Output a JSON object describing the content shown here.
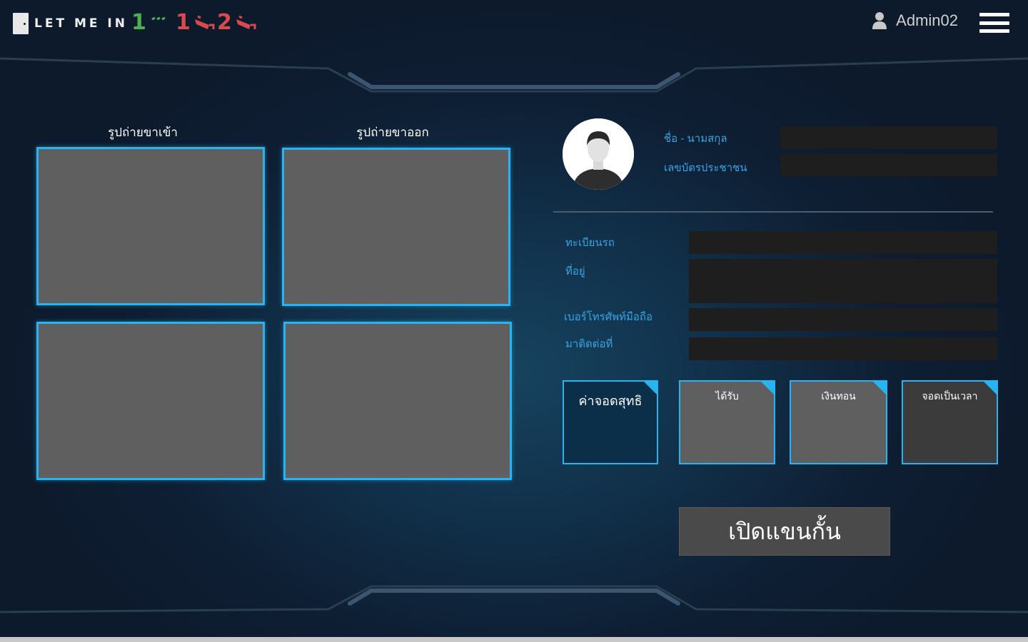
{
  "app": {
    "logo_text": "LET ME IN"
  },
  "status": {
    "gate_count": "1",
    "camera1_count": "1",
    "camera2_count": "2"
  },
  "user": {
    "name": "Admin02"
  },
  "photos": {
    "entry_title": "รูปถ่ายขาเข้า",
    "exit_title": "รูปถ่ายขาออก"
  },
  "profile": {
    "name_label": "ชื่อ - นามสกุล",
    "id_label": "เลขบัตรประชาชน",
    "name_value": "",
    "id_value": ""
  },
  "vehicle": {
    "plate_label": "ทะเบียนรถ",
    "address_label": "ที่อยู่",
    "phone_label": "เบอร์โทรศัพท์มือถือ",
    "contact_label": "มาติดต่อที่",
    "plate_value": "",
    "address_value": "",
    "phone_value": "",
    "contact_value": ""
  },
  "tiles": [
    {
      "label": "ค่าจอดสุทธิ",
      "color": "#0b2f48"
    },
    {
      "label": "ได้รับ",
      "color": "#5f5f5f"
    },
    {
      "label": "เงินทอน",
      "color": "#5f5f5f"
    },
    {
      "label": "จอดเป็นเวลา",
      "color": "#3b3b3b"
    }
  ],
  "actions": {
    "open_gate_label": "เปิดแขนกั้น"
  },
  "colors": {
    "accent": "#27b4f0",
    "label": "#3aa3e3",
    "status_green": "#4caf50",
    "status_red": "#d94a4a"
  }
}
